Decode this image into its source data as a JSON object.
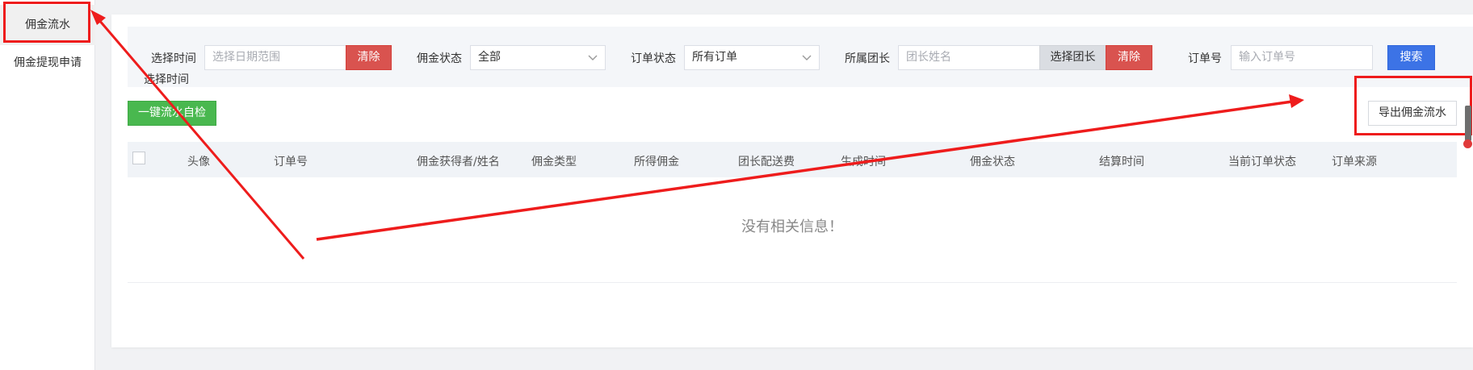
{
  "sidebar": {
    "items": [
      {
        "label": "佣金流水",
        "active": true
      },
      {
        "label": "佣金提现申请",
        "active": false
      }
    ]
  },
  "filters": {
    "time_label": "选择时间",
    "time_placeholder": "选择日期范围",
    "time_clear": "清除",
    "commission_status_label": "佣金状态",
    "commission_status_value": "全部",
    "order_status_label": "订单状态",
    "order_status_value": "所有订单",
    "team_label": "所属团长",
    "team_placeholder": "团长姓名",
    "team_select": "选择团长",
    "team_clear": "清除",
    "order_no_label": "订单号",
    "order_no_placeholder": "输入订单号",
    "search": "搜索"
  },
  "actions": {
    "self_check": "一键流水自检",
    "export": "导出佣金流水"
  },
  "table": {
    "columns": [
      "头像",
      "订单号",
      "佣金获得者/姓名",
      "佣金类型",
      "所得佣金",
      "团长配送费",
      "生成时间",
      "佣金状态",
      "结算时间",
      "当前订单状态",
      "订单来源"
    ],
    "empty_text": "没有相关信息！"
  },
  "colors": {
    "danger": "#d9534f",
    "primary": "#3c73e6",
    "success": "#49b84f",
    "annotation": "#ee1c1c"
  }
}
